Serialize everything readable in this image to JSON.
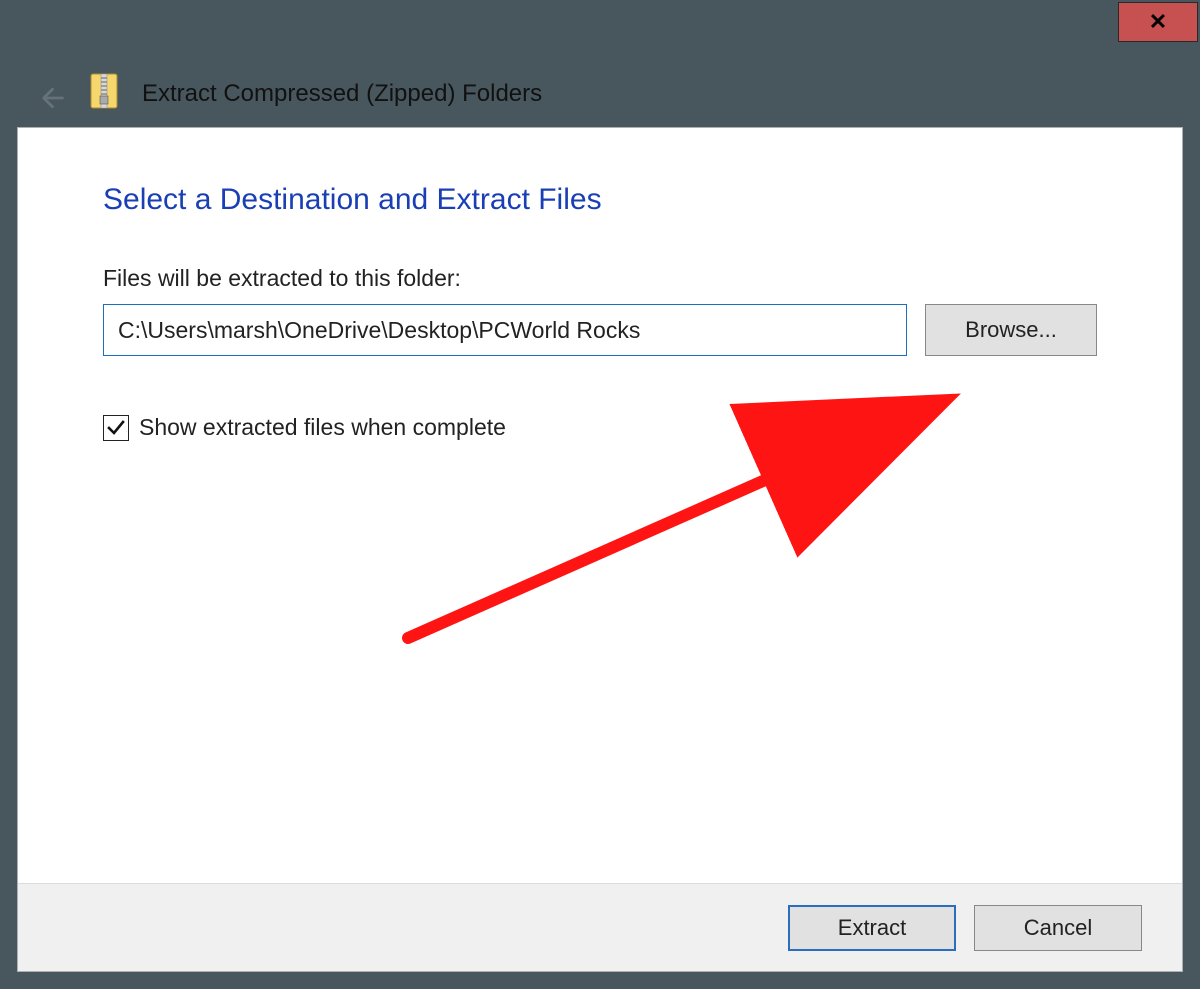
{
  "window": {
    "title": "Extract Compressed (Zipped) Folders"
  },
  "heading": "Select a Destination and Extract Files",
  "folder_label": "Files will be extracted to this folder:",
  "folder_path": "C:\\Users\\marsh\\OneDrive\\Desktop\\PCWorld Rocks",
  "browse_label": "Browse...",
  "checkbox": {
    "label": "Show extracted files when complete",
    "checked": true
  },
  "buttons": {
    "extract": "Extract",
    "cancel": "Cancel",
    "close_glyph": "✕"
  },
  "colors": {
    "chrome": "#48575e",
    "close_bg": "#c75050",
    "heading": "#1a3fb5",
    "annotation": "#ff1414"
  }
}
